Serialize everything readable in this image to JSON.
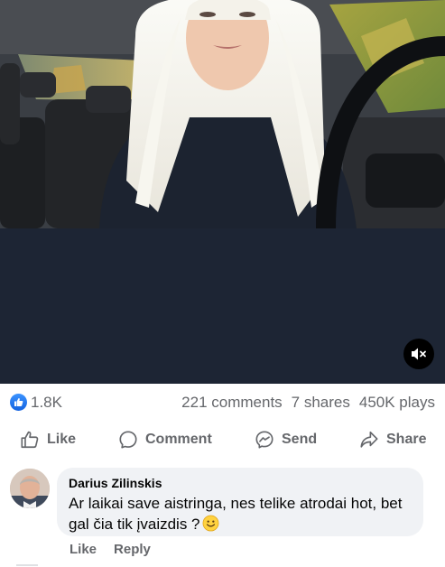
{
  "video": {
    "muted": true,
    "mute_icon": "speaker-muted-icon"
  },
  "stats": {
    "reactions_count": "1.8K",
    "reaction_icon": "thumbs-up-icon",
    "comments": "221 comments",
    "shares": "7 shares",
    "plays": "450K plays"
  },
  "actions": {
    "like": "Like",
    "comment": "Comment",
    "send": "Send",
    "share": "Share"
  },
  "comment": {
    "author": "Darius Zilinskis",
    "text": "Ar laikai save aistringa, nes telike atrodai hot, bet gal čia tik įvaizdis ?",
    "emoji": "slightly-smiling-face",
    "like_label": "Like",
    "reply_label": "Reply"
  },
  "colors": {
    "accent": "#1877f2",
    "secondary_text": "#65676b",
    "bubble": "#f0f2f5",
    "video_background": "#1d2534"
  }
}
